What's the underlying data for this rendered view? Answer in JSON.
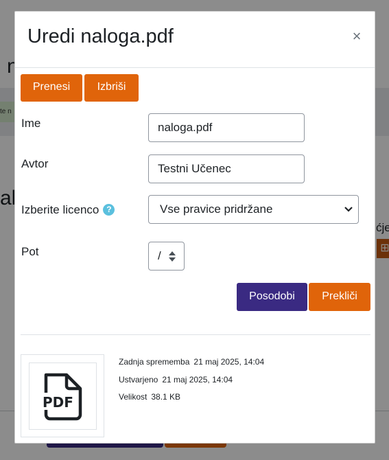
{
  "background": {
    "heading_fragment": "n",
    "heading_fragment_2": "alo",
    "notice_fragment": "te n",
    "right_fragment": "ćje",
    "grid_icon": "grid-icon"
  },
  "dialog": {
    "title": "Uredi naloga.pdf",
    "close_glyph": "×",
    "buttons": {
      "upload": "Prenesi",
      "delete": "Izbriši",
      "update": "Posodobi",
      "cancel": "Prekliči"
    },
    "fields": {
      "name_label": "Ime",
      "name_value": "naloga.pdf",
      "author_label": "Avtor",
      "author_value": "Testni Učenec",
      "license_label": "Izberite licenco",
      "license_help_glyph": "?",
      "license_value": "Vse pravice pridržane",
      "path_label": "Pot",
      "path_value": "/"
    },
    "file_info": {
      "modified_label": "Zadnja sprememba",
      "modified_value": "21 maj 2025, 14:04",
      "created_label": "Ustvarjeno",
      "created_value": "21 maj 2025, 14:04",
      "size_label": "Velikost",
      "size_value": "38.1 KB"
    },
    "thumbnail": {
      "icon": "pdf-file-icon",
      "icon_text": "PDF"
    }
  },
  "colors": {
    "primary_orange": "#e0640a",
    "primary_purple": "#3a2a82",
    "help_icon": "#5bc0de"
  }
}
